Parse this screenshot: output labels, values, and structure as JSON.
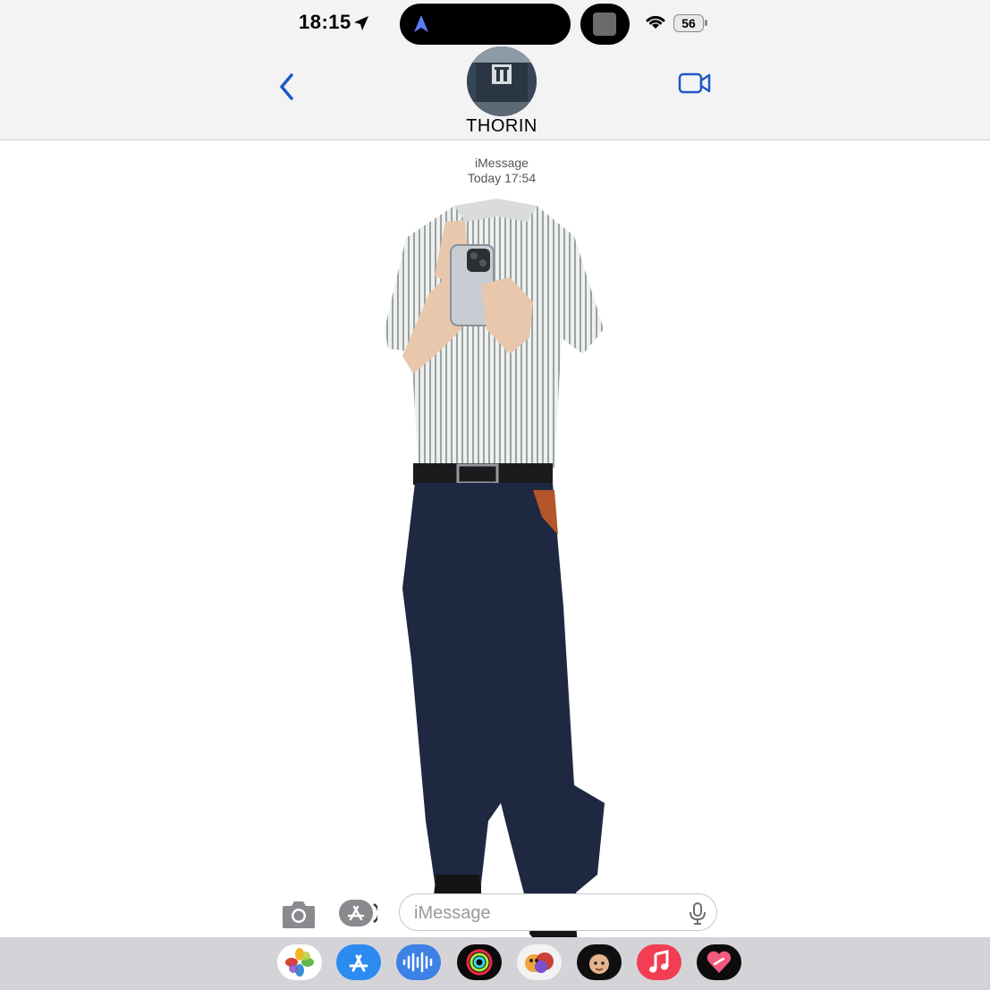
{
  "status_bar": {
    "time": "18:15",
    "battery": "56",
    "location_icon": "location-arrow-icon",
    "wifi_icon": "wifi-icon",
    "island_icon": "navigation-arrow-icon"
  },
  "conversation": {
    "contact_name": "THORIN",
    "back_icon": "chevron-left-icon",
    "video_icon": "video-camera-icon",
    "accent_color": "#1f57c8"
  },
  "thread": {
    "service_label": "iMessage",
    "timestamp": "Today 17:54"
  },
  "composer": {
    "placeholder": "iMessage",
    "camera_icon": "camera-icon",
    "apps_icon": "app-store-icon",
    "mic_icon": "microphone-icon"
  },
  "app_drawer": {
    "apps": [
      {
        "name": "photos",
        "icon": "photos-icon"
      },
      {
        "name": "app-store",
        "icon": "app-store-icon"
      },
      {
        "name": "audio-message",
        "icon": "waveform-icon"
      },
      {
        "name": "fitness",
        "icon": "activity-rings-icon"
      },
      {
        "name": "memoji-stickers",
        "icon": "memoji-icon"
      },
      {
        "name": "memoji-face",
        "icon": "memoji-face-icon"
      },
      {
        "name": "music",
        "icon": "music-note-icon"
      },
      {
        "name": "digital-touch",
        "icon": "heart-icon"
      }
    ]
  }
}
